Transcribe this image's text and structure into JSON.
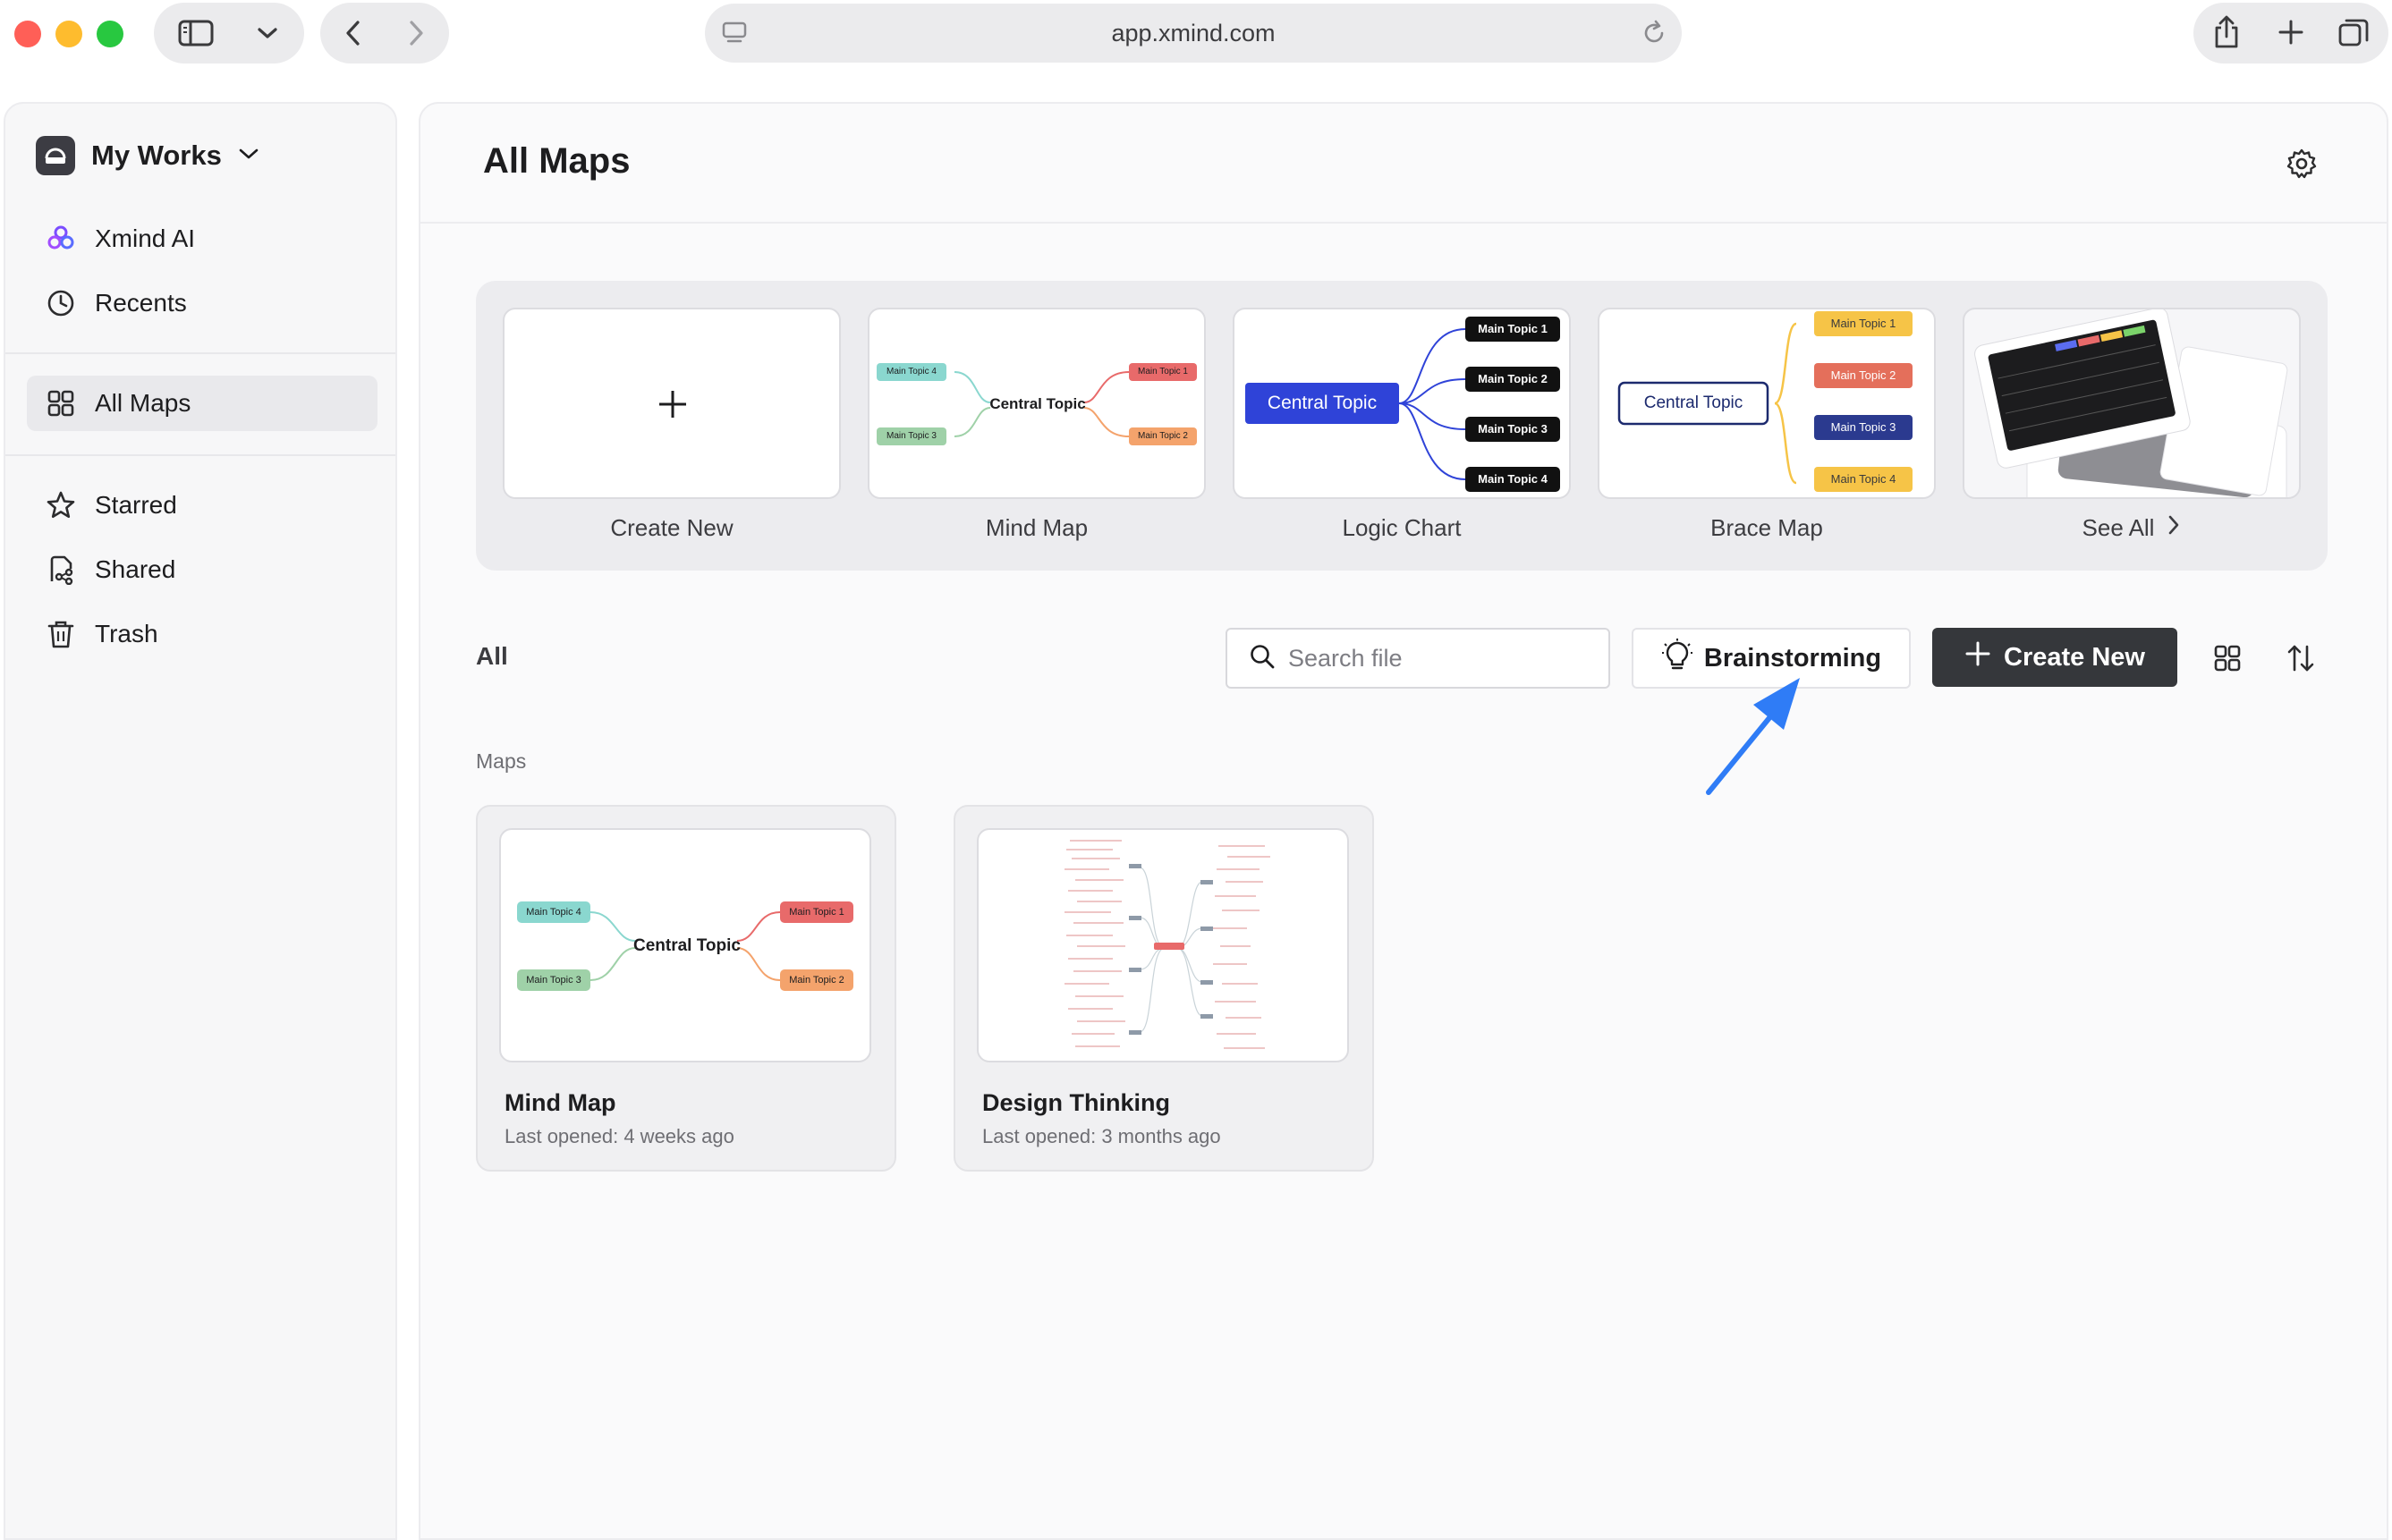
{
  "browser": {
    "url": "app.xmind.com"
  },
  "sidebar": {
    "workspace": "My Works",
    "items": [
      {
        "label": "Xmind AI",
        "icon": "xmind-ai-icon"
      },
      {
        "label": "Recents",
        "icon": "clock-icon"
      },
      {
        "label": "All Maps",
        "icon": "grid-icon",
        "active": true
      },
      {
        "label": "Starred",
        "icon": "star-icon"
      },
      {
        "label": "Shared",
        "icon": "shared-icon"
      },
      {
        "label": "Trash",
        "icon": "trash-icon"
      }
    ]
  },
  "main": {
    "title": "All Maps",
    "templates": [
      {
        "label": "Create New"
      },
      {
        "label": "Mind Map"
      },
      {
        "label": "Logic Chart"
      },
      {
        "label": "Brace Map"
      },
      {
        "label": "See All"
      }
    ],
    "template_previews": {
      "central": "Central Topic",
      "topic1": "Main Topic 1",
      "topic2": "Main Topic 2",
      "topic3": "Main Topic 3",
      "topic4": "Main Topic 4"
    },
    "filter": "All",
    "search_placeholder": "Search file",
    "brainstorm_label": "Brainstorming",
    "create_label": "Create New",
    "section_label": "Maps",
    "files": [
      {
        "name": "Mind Map",
        "meta": "Last opened: 4 weeks ago"
      },
      {
        "name": "Design Thinking",
        "meta": "Last opened: 3 months ago"
      }
    ]
  },
  "colors": {
    "accent_blue": "#2f43d8",
    "arrow_blue": "#2f7cf6",
    "dark_button": "#35373b",
    "topic_red": "#e86a6a",
    "topic_orange": "#f4a36c",
    "topic_teal": "#8ad7cf",
    "topic_green": "#9fd1a8",
    "topic_yellow": "#f6c447",
    "topic_navy": "#2b3a8f"
  }
}
